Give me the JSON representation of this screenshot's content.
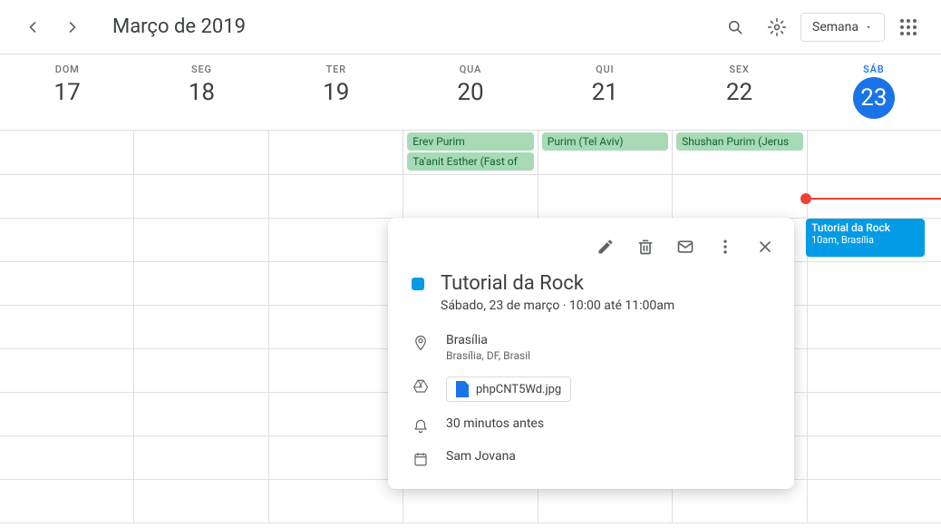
{
  "header": {
    "title": "Março de 2019",
    "view_label": "Semana"
  },
  "days": [
    {
      "abbr": "DOM",
      "num": "17",
      "today": false
    },
    {
      "abbr": "SEG",
      "num": "18",
      "today": false
    },
    {
      "abbr": "TER",
      "num": "19",
      "today": false
    },
    {
      "abbr": "QUA",
      "num": "20",
      "today": false
    },
    {
      "abbr": "QUI",
      "num": "21",
      "today": false
    },
    {
      "abbr": "SEX",
      "num": "22",
      "today": false
    },
    {
      "abbr": "SÁB",
      "num": "23",
      "today": true
    }
  ],
  "allday": {
    "wed": [
      "Erev Purim",
      "Ta'anit Esther (Fast of"
    ],
    "thu": [
      "Purim (Tel Aviv)"
    ],
    "fri": [
      "Shushan Purim (Jerus"
    ]
  },
  "event": {
    "title": "Tutorial da Rock",
    "time_loc": "10am, Brasília"
  },
  "popover": {
    "title": "Tutorial da Rock",
    "subtitle": "Sábado, 23 de março  ·  10:00 até 11:00am",
    "location": "Brasília",
    "location_detail": "Brasília, DF, Brasil",
    "attachment": "phpCNT5Wd.jpg",
    "reminder": "30 minutos antes",
    "organizer": "Sam Jovana"
  }
}
